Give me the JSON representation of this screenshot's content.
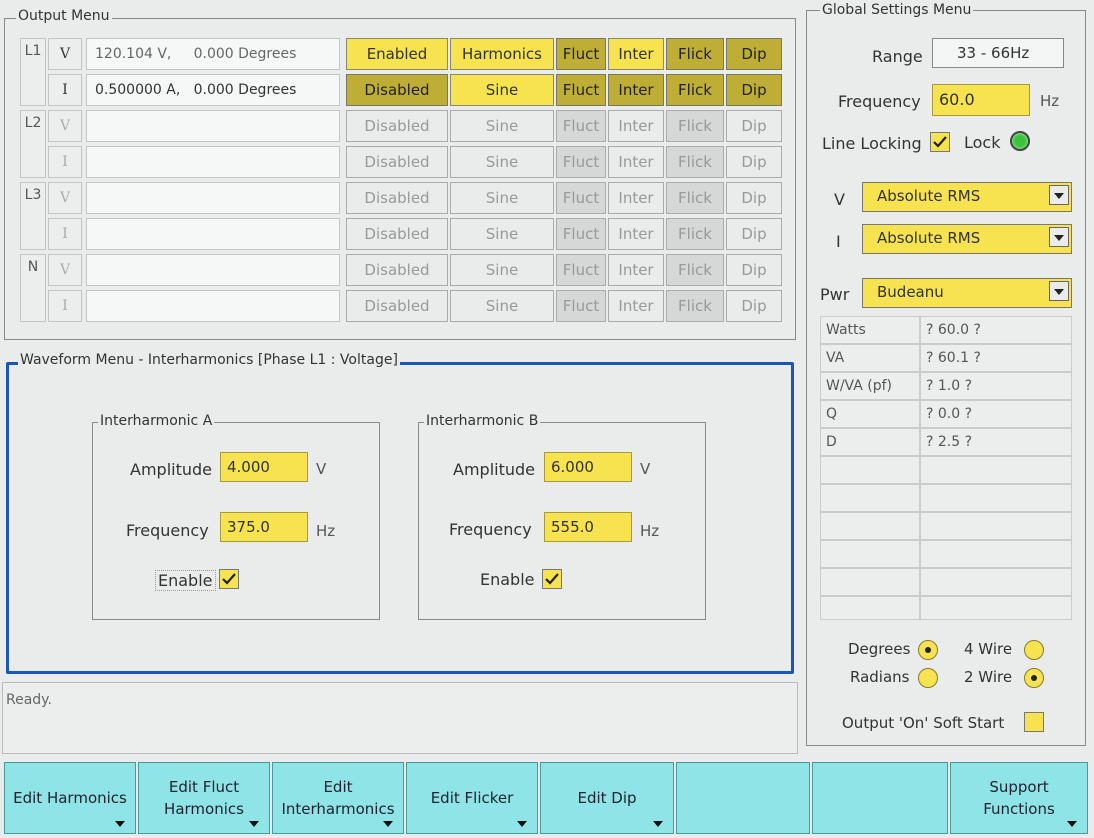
{
  "output_menu": {
    "legend": "Output Menu",
    "rows": [
      {
        "phase": "L1",
        "ch": "V",
        "value": "120.104 V,     0.000 Degrees",
        "btns": [
          "Enabled",
          "Harmonics",
          "Fluct",
          "Inter",
          "Flick",
          "Dip"
        ]
      },
      {
        "phase": "",
        "ch": "I",
        "value": "0.500000 A,   0.000 Degrees",
        "btns": [
          "Disabled",
          "Sine",
          "Fluct",
          "Inter",
          "Flick",
          "Dip"
        ]
      },
      {
        "phase": "L2",
        "ch": "V",
        "value": "",
        "btns": [
          "Disabled",
          "Sine",
          "Fluct",
          "Inter",
          "Flick",
          "Dip"
        ]
      },
      {
        "phase": "",
        "ch": "I",
        "value": "",
        "btns": [
          "Disabled",
          "Sine",
          "Fluct",
          "Inter",
          "Flick",
          "Dip"
        ]
      },
      {
        "phase": "L3",
        "ch": "V",
        "value": "",
        "btns": [
          "Disabled",
          "Sine",
          "Fluct",
          "Inter",
          "Flick",
          "Dip"
        ]
      },
      {
        "phase": "",
        "ch": "I",
        "value": "",
        "btns": [
          "Disabled",
          "Sine",
          "Fluct",
          "Inter",
          "Flick",
          "Dip"
        ]
      },
      {
        "phase": "N",
        "ch": "V",
        "value": "",
        "btns": [
          "Disabled",
          "Sine",
          "Fluct",
          "Inter",
          "Flick",
          "Dip"
        ]
      },
      {
        "phase": "",
        "ch": "I",
        "value": "",
        "btns": [
          "Disabled",
          "Sine",
          "Fluct",
          "Inter",
          "Flick",
          "Dip"
        ]
      }
    ]
  },
  "waveform": {
    "legend": "Waveform Menu - Interharmonics [Phase L1 : Voltage]",
    "a": {
      "legend": "Interharmonic A",
      "amp_label": "Amplitude",
      "amp": "4.000",
      "amp_unit": "V",
      "freq_label": "Frequency",
      "freq": "375.0",
      "freq_unit": "Hz",
      "enable_label": "Enable"
    },
    "b": {
      "legend": "Interharmonic B",
      "amp_label": "Amplitude",
      "amp": "6.000",
      "amp_unit": "V",
      "freq_label": "Frequency",
      "freq": "555.0",
      "freq_unit": "Hz",
      "enable_label": "Enable"
    }
  },
  "status": "Ready.",
  "global": {
    "legend": "Global Settings Menu",
    "range_label": "Range",
    "range": "33 - 66Hz",
    "freq_label": "Frequency",
    "freq": "60.0",
    "freq_unit": "Hz",
    "line_locking_label": "Line Locking",
    "lock_label": "Lock",
    "v_label": "V",
    "v_mode": "Absolute RMS",
    "i_label": "I",
    "i_mode": "Absolute RMS",
    "pwr_label": "Pwr",
    "pwr_mode": "Budeanu",
    "measurements": [
      {
        "name": "Watts",
        "value": "? 60.0 ?"
      },
      {
        "name": "VA",
        "value": "? 60.1 ?"
      },
      {
        "name": "W/VA (pf)",
        "value": "? 1.0 ?"
      },
      {
        "name": "Q",
        "value": "? 0.0 ?"
      },
      {
        "name": "D",
        "value": "? 2.5 ?"
      }
    ],
    "degrees_label": "Degrees",
    "radians_label": "Radians",
    "four_wire_label": "4 Wire",
    "two_wire_label": "2 Wire",
    "soft_start_label": "Output 'On' Soft Start"
  },
  "fkeys": [
    "Edit Harmonics",
    "Edit Fluct\nHarmonics",
    "Edit\nInterharmonics",
    "Edit Flicker",
    "Edit Dip",
    "",
    "",
    "Support\nFunctions"
  ],
  "colors": {
    "accent_yellow": "#f6e34f",
    "dark_yellow": "#bfae36",
    "fkey_cyan": "#8ee4e6",
    "waveform_border": "#1a56b8",
    "lock_led": "#3cc23c"
  }
}
